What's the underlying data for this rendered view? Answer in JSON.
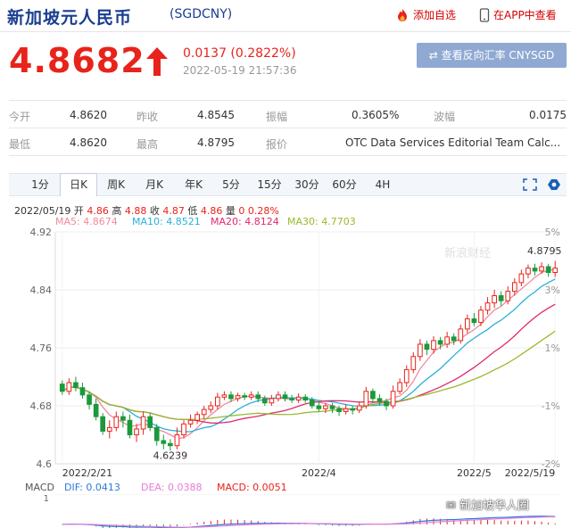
{
  "header": {
    "title": "新加坡元人民币",
    "code": "(SGDCNY)",
    "add_favorite": "添加自选",
    "view_in_app": "在APP中查看"
  },
  "quote": {
    "price": "4.8682",
    "change": "0.0137 (0.2822%)",
    "datetime": "2022-05-19 21:57:36",
    "reverse_button": "查看反向汇率 CNYSGD"
  },
  "stats": {
    "open_label": "今开",
    "open": "4.8620",
    "prev_close_label": "昨收",
    "prev_close": "4.8545",
    "amplitude_label": "振幅",
    "amplitude": "0.3605%",
    "spread_label": "波幅",
    "spread": "0.0175",
    "low_label": "最低",
    "low": "4.8620",
    "high_label": "最高",
    "high": "4.8795",
    "quote_by_label": "报价",
    "quote_by": "OTC Data Services Editorial Team Calc..."
  },
  "tabs": [
    "1分",
    "日K",
    "周K",
    "月K",
    "年K",
    "5分",
    "15分",
    "30分",
    "60分",
    "4H"
  ],
  "active_tab": "日K",
  "ohlc_line": {
    "date": "2022/05/19",
    "open_label": "开",
    "open": "4.86",
    "high_label": "高",
    "high": "4.88",
    "close_label": "收",
    "close": "4.87",
    "low_label": "低",
    "low": "4.86",
    "volume_label": "量",
    "volume": "0",
    "pct": "0.28%"
  },
  "ma_legend": {
    "ma5": "MA5: 4.8674",
    "ma10": "MA10: 4.8521",
    "ma20": "MA20: 4.8124",
    "ma30": "MA30: 4.7703"
  },
  "colors": {
    "up": "#e8231b",
    "down": "#1a9a3a",
    "ma5": "#f08aa0",
    "ma10": "#2bb0d8",
    "ma20": "#e0286e",
    "ma30": "#99b92d",
    "dif": "#2b7bd8",
    "dea": "#e87ad8",
    "macd": "#e8231b"
  },
  "chart_data": {
    "type": "candlestick",
    "y_ticks": [
      "4.92",
      "4.84",
      "4.76",
      "4.68",
      "4.6"
    ],
    "pct_ticks": [
      "5%",
      "3%",
      "1%",
      "-1%",
      "-2%"
    ],
    "x_ticks": [
      "2022/2/21",
      "2022/4",
      "2022/5",
      "2022/5/19"
    ],
    "ylim": [
      4.6,
      4.92
    ],
    "annotations": {
      "max": "4.8795",
      "min": "4.6239"
    },
    "watermark": "新浪财经",
    "candles": [
      [
        4.71,
        4.7,
        4.715,
        4.695
      ],
      [
        4.7,
        4.712,
        4.718,
        4.695
      ],
      [
        4.712,
        4.705,
        4.72,
        4.7
      ],
      [
        4.705,
        4.695,
        4.712,
        4.69
      ],
      [
        4.695,
        4.682,
        4.7,
        4.675
      ],
      [
        4.682,
        4.665,
        4.69,
        4.66
      ],
      [
        4.665,
        4.645,
        4.67,
        4.64
      ],
      [
        4.645,
        4.65,
        4.66,
        4.635
      ],
      [
        4.65,
        4.665,
        4.672,
        4.645
      ],
      [
        4.665,
        4.66,
        4.672,
        4.65
      ],
      [
        4.66,
        4.64,
        4.668,
        4.635
      ],
      [
        4.64,
        4.648,
        4.655,
        4.63
      ],
      [
        4.648,
        4.665,
        4.672,
        4.64
      ],
      [
        4.665,
        4.65,
        4.67,
        4.645
      ],
      [
        4.65,
        4.632,
        4.655,
        4.625
      ],
      [
        4.632,
        4.628,
        4.64,
        4.62
      ],
      [
        4.628,
        4.625,
        4.634,
        4.618
      ],
      [
        4.625,
        4.64,
        4.65,
        4.62
      ],
      [
        4.64,
        4.655,
        4.66,
        4.635
      ],
      [
        4.655,
        4.66,
        4.668,
        4.65
      ],
      [
        4.66,
        4.668,
        4.672,
        4.655
      ],
      [
        4.668,
        4.675,
        4.68,
        4.662
      ],
      [
        4.675,
        4.68,
        4.686,
        4.67
      ],
      [
        4.68,
        4.692,
        4.698,
        4.675
      ],
      [
        4.692,
        4.695,
        4.7,
        4.688
      ],
      [
        4.695,
        4.69,
        4.7,
        4.685
      ],
      [
        4.69,
        4.694,
        4.698,
        4.686
      ],
      [
        4.694,
        4.692,
        4.698,
        4.688
      ],
      [
        4.692,
        4.695,
        4.7,
        4.688
      ],
      [
        4.695,
        4.69,
        4.7,
        4.685
      ],
      [
        4.69,
        4.684,
        4.694,
        4.68
      ],
      [
        4.684,
        4.69,
        4.695,
        4.68
      ],
      [
        4.69,
        4.695,
        4.7,
        4.686
      ],
      [
        4.695,
        4.69,
        4.7,
        4.686
      ],
      [
        4.69,
        4.688,
        4.695,
        4.684
      ],
      [
        4.688,
        4.692,
        4.697,
        4.684
      ],
      [
        4.692,
        4.688,
        4.696,
        4.684
      ],
      [
        4.688,
        4.68,
        4.692,
        4.676
      ],
      [
        4.68,
        4.676,
        4.686,
        4.672
      ],
      [
        4.676,
        4.68,
        4.684,
        4.67
      ],
      [
        4.68,
        4.676,
        4.684,
        4.67
      ],
      [
        4.676,
        4.672,
        4.68,
        4.666
      ],
      [
        4.672,
        4.676,
        4.682,
        4.668
      ],
      [
        4.676,
        4.674,
        4.68,
        4.668
      ],
      [
        4.674,
        4.68,
        4.686,
        4.67
      ],
      [
        4.68,
        4.7,
        4.706,
        4.676
      ],
      [
        4.7,
        4.69,
        4.704,
        4.684
      ],
      [
        4.69,
        4.686,
        4.696,
        4.68
      ],
      [
        4.686,
        4.68,
        4.69,
        4.674
      ],
      [
        4.68,
        4.7,
        4.708,
        4.676
      ],
      [
        4.7,
        4.712,
        4.718,
        4.696
      ],
      [
        4.712,
        4.73,
        4.736,
        4.706
      ],
      [
        4.73,
        4.748,
        4.754,
        4.725
      ],
      [
        4.748,
        4.765,
        4.772,
        4.742
      ],
      [
        4.765,
        4.758,
        4.77,
        4.75
      ],
      [
        4.758,
        4.77,
        4.776,
        4.752
      ],
      [
        4.77,
        4.765,
        4.775,
        4.758
      ],
      [
        4.765,
        4.775,
        4.782,
        4.76
      ],
      [
        4.775,
        4.77,
        4.78,
        4.764
      ],
      [
        4.77,
        4.786,
        4.792,
        4.766
      ],
      [
        4.786,
        4.8,
        4.806,
        4.78
      ],
      [
        4.8,
        4.795,
        4.808,
        4.79
      ],
      [
        4.795,
        4.812,
        4.818,
        4.79
      ],
      [
        4.812,
        4.822,
        4.83,
        4.806
      ],
      [
        4.822,
        4.832,
        4.84,
        4.815
      ],
      [
        4.832,
        4.825,
        4.838,
        4.818
      ],
      [
        4.825,
        4.838,
        4.845,
        4.82
      ],
      [
        4.838,
        4.85,
        4.856,
        4.832
      ],
      [
        4.85,
        4.862,
        4.868,
        4.845
      ],
      [
        4.862,
        4.87,
        4.875,
        4.856
      ],
      [
        4.87,
        4.866,
        4.876,
        4.86
      ],
      [
        4.866,
        4.872,
        4.878,
        4.862
      ],
      [
        4.872,
        4.864,
        4.876,
        4.858
      ],
      [
        4.864,
        4.87,
        4.88,
        4.858
      ]
    ],
    "macd": {
      "dif": "DIF: 0.0413",
      "dea": "DEA: 0.0388",
      "macd": "MACD: 0.0051",
      "label": "MACD",
      "axis_top": "1"
    }
  },
  "footer_watermark": "新加坡华人圈"
}
